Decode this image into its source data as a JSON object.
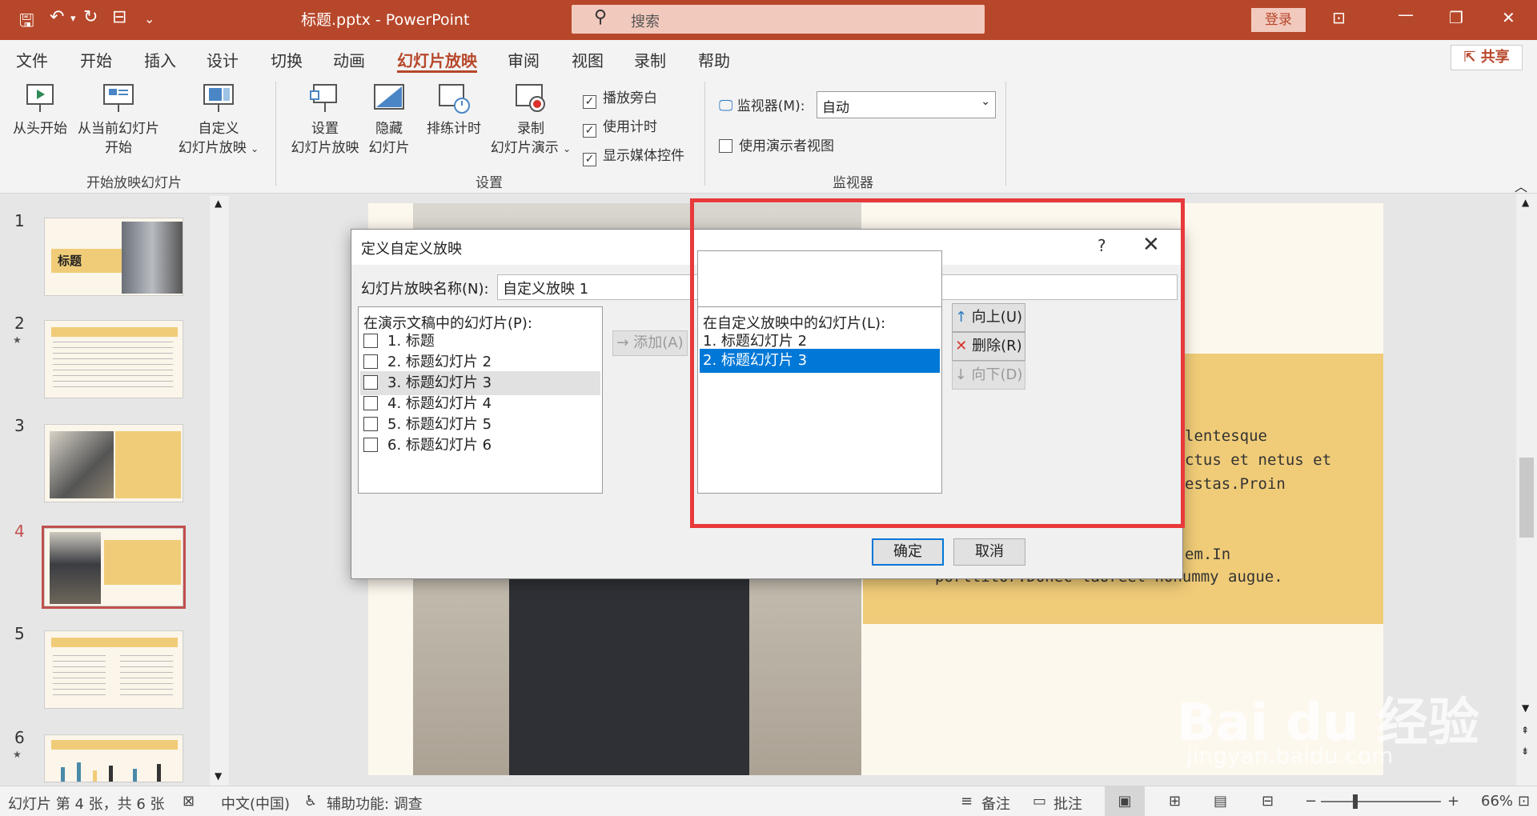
{
  "titlebar": {
    "doc_title": "标题.pptx  -  PowerPoint",
    "search_placeholder": "搜索",
    "login": "登录"
  },
  "menu": {
    "tabs": [
      "文件",
      "开始",
      "插入",
      "设计",
      "切换",
      "动画",
      "幻灯片放映",
      "审阅",
      "视图",
      "录制",
      "帮助"
    ],
    "active_tab": "幻灯片放映",
    "share": "共享"
  },
  "ribbon": {
    "start_group": {
      "from_beginning": "从头开始",
      "from_current_1": "从当前幻灯片",
      "from_current_2": "开始",
      "custom_1": "自定义",
      "custom_2": "幻灯片放映",
      "label": "开始放映幻灯片"
    },
    "setup_group": {
      "setup_1": "设置",
      "setup_2": "幻灯片放映",
      "hide_1": "隐藏",
      "hide_2": "幻灯片",
      "rehearse": "排练计时",
      "record_1": "录制",
      "record_2": "幻灯片演示",
      "play_narration": "播放旁白",
      "use_timings": "使用计时",
      "show_media": "显示媒体控件",
      "label": "设置"
    },
    "monitor_group": {
      "monitor_label": "监视器(M):",
      "monitor_value": "自动",
      "presenter_view": "使用演示者视图",
      "label": "监视器"
    }
  },
  "thumbnails": {
    "numbers": [
      "1",
      "2",
      "3",
      "4",
      "5",
      "6"
    ],
    "selected": "4",
    "slide1_title": "标题"
  },
  "slide": {
    "lines": [
      "lentesque",
      "ctus et netus et",
      "estas.Proin",
      "em.In",
      "porttitor.Donec laoreet nonummy augue."
    ]
  },
  "dialog": {
    "title": "定义自定义放映",
    "help": "?",
    "close": "✕",
    "name_label": "幻灯片放映名称(N):",
    "name_value": "自定义放映 1",
    "left_caption": "在演示文稿中的幻灯片(P):",
    "left_items": [
      "1. 标题",
      "2. 标题幻灯片 2",
      "3. 标题幻灯片 3",
      "4. 标题幻灯片 4",
      "5. 标题幻灯片 5",
      "6. 标题幻灯片 6"
    ],
    "add": "添加(A)",
    "right_caption": "在自定义放映中的幻灯片(L):",
    "right_items": [
      "1. 标题幻灯片 2",
      "2. 标题幻灯片 3"
    ],
    "up": "向上(U)",
    "delete": "删除(R)",
    "down": "向下(D)",
    "ok": "确定",
    "cancel": "取消"
  },
  "status": {
    "slide_info": "幻灯片 第 4 张，共 6 张",
    "language": "中文(中国)",
    "accessibility": "辅助功能: 调查",
    "notes": "备注",
    "comments": "批注",
    "zoom": "66%"
  },
  "watermark": {
    "brand": "Bai du 经验",
    "url": "jingyan.baidu.com"
  },
  "colors": {
    "accent": "#b7472a",
    "selection": "#0078d7",
    "annotation": "#e8393b"
  }
}
